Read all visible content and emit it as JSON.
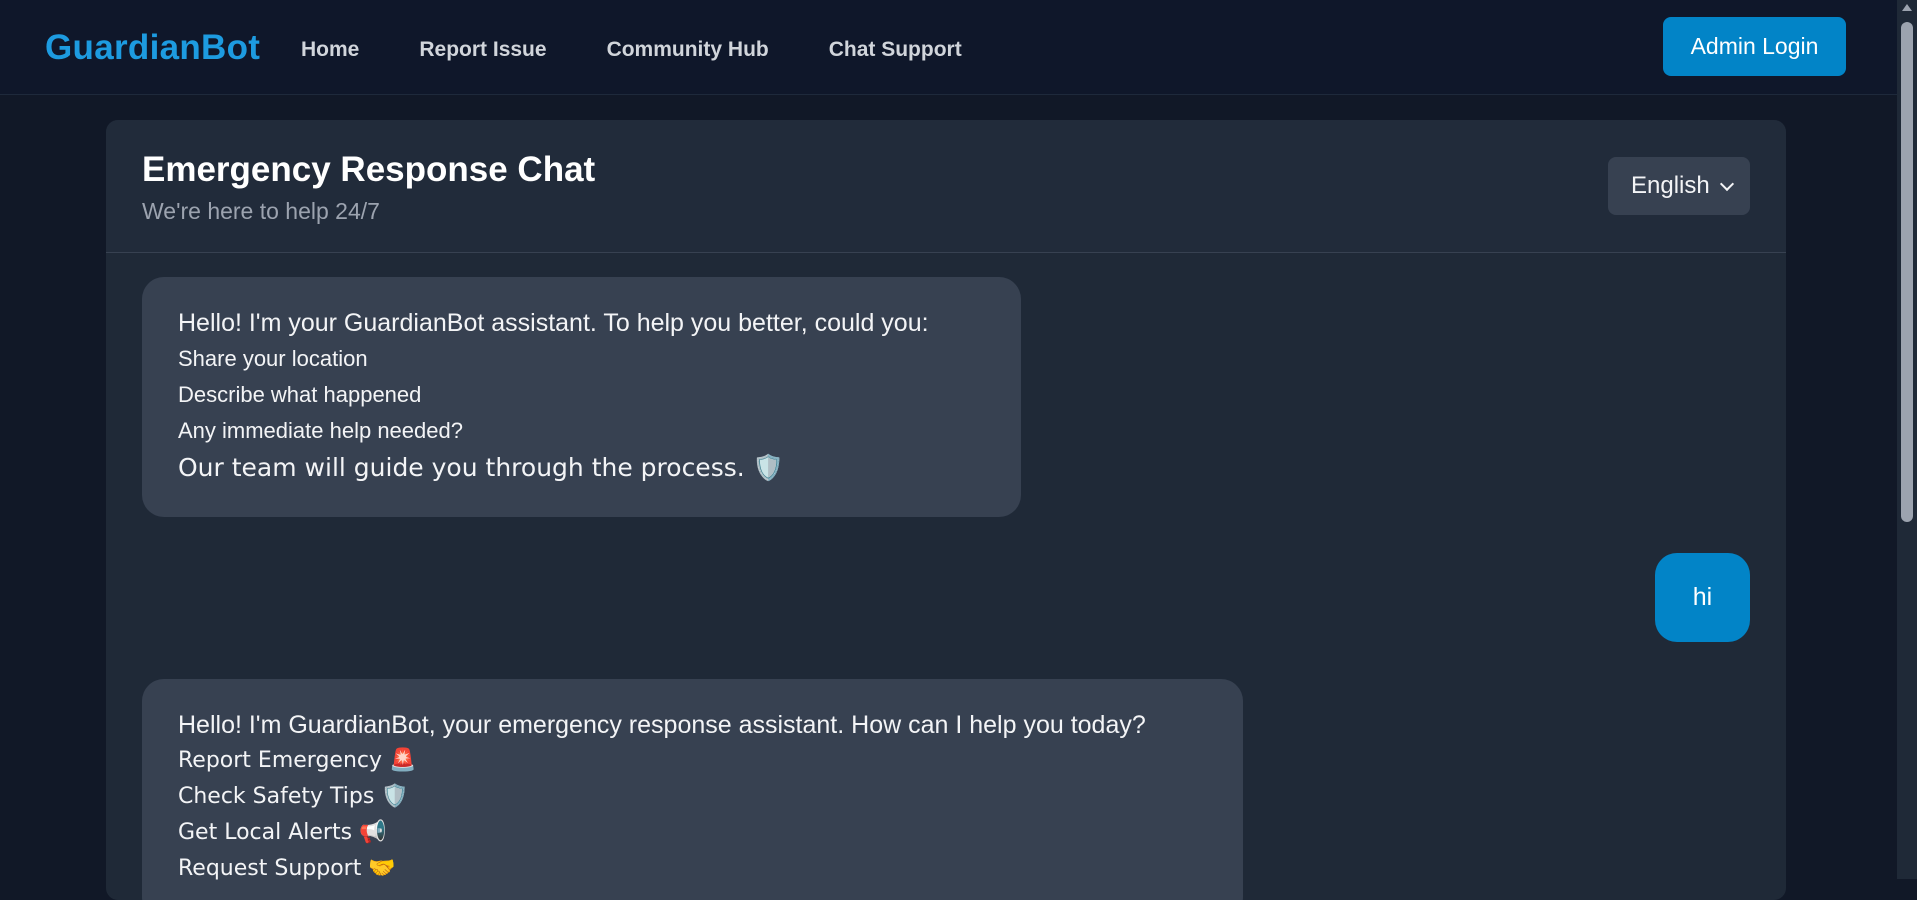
{
  "brand": "GuardianBot",
  "nav": {
    "links": [
      "Home",
      "Report Issue",
      "Community Hub",
      "Chat Support"
    ],
    "admin_label": "Admin Login"
  },
  "chat": {
    "title": "Emergency Response Chat",
    "subtitle": "We're here to help 24/7",
    "language": "English",
    "messages": [
      {
        "from": "bot",
        "intro": "Hello! I'm your GuardianBot assistant. To help you better, could you:",
        "items": [
          "Share your location",
          "Describe what happened",
          "Any immediate help needed?"
        ],
        "outro": "Our team will guide you through the process. 🛡️"
      },
      {
        "from": "user",
        "text": "hi"
      },
      {
        "from": "bot",
        "intro": "Hello! I'm GuardianBot, your emergency response assistant. How can I help you today?",
        "items": [
          "Report Emergency 🚨",
          "Check Safety Tips 🛡️",
          "Get Local Alerts 📢",
          "Request Support 🤝"
        ]
      }
    ]
  },
  "colors": {
    "background": "#111827",
    "brand": "#1d9be0",
    "accent_button": "#0284c7",
    "bot_bubble": "#374151"
  }
}
